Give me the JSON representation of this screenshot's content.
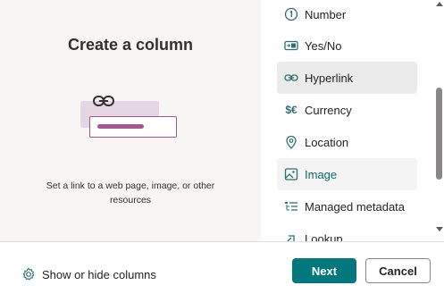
{
  "left": {
    "title": "Create a column",
    "description": "Set a link to a web page, image, or other resources"
  },
  "column_types": [
    {
      "label": "Number",
      "icon": "number-circle-icon",
      "state": "normal"
    },
    {
      "label": "Yes/No",
      "icon": "toggle-icon",
      "state": "normal"
    },
    {
      "label": "Hyperlink",
      "icon": "link-icon",
      "state": "hover"
    },
    {
      "label": "Currency",
      "icon": "currency-icon",
      "state": "normal"
    },
    {
      "label": "Location",
      "icon": "location-pin-icon",
      "state": "normal"
    },
    {
      "label": "Image",
      "icon": "image-icon",
      "state": "selected"
    },
    {
      "label": "Managed metadata",
      "icon": "managed-metadata-icon",
      "state": "normal"
    },
    {
      "label": "Lookup",
      "icon": "lookup-icon",
      "state": "normal"
    }
  ],
  "footer": {
    "show_hide_label": "Show or hide columns",
    "next_label": "Next",
    "cancel_label": "Cancel"
  },
  "colors": {
    "accent": "#03787c",
    "illustration_accent": "#a4588f"
  }
}
